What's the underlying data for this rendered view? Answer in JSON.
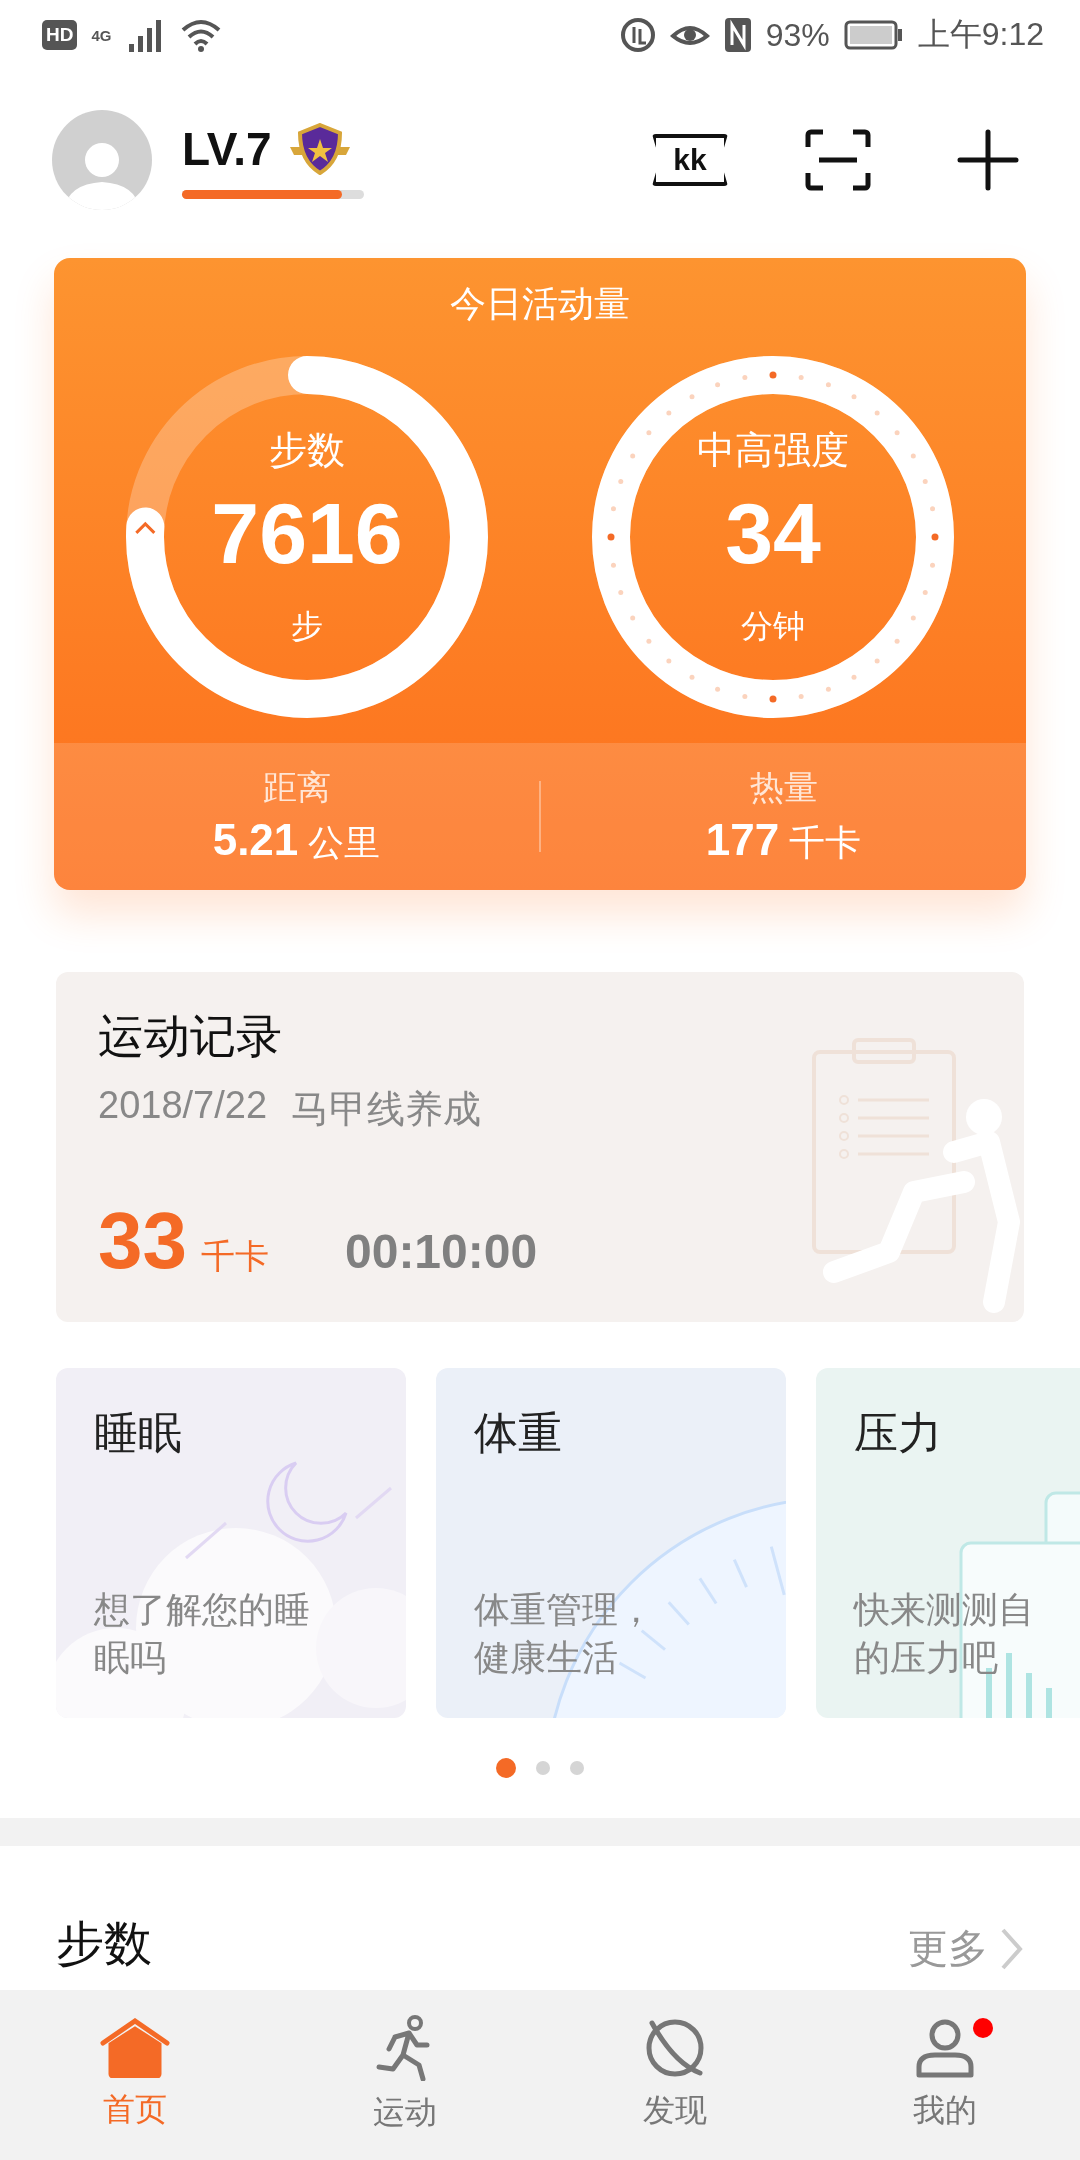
{
  "status_bar": {
    "hd": "HD",
    "network": "4G",
    "battery": "93%",
    "time": "上午9:12"
  },
  "header": {
    "level_label": "LV.7",
    "level": 0.88,
    "ticket_label": "kk"
  },
  "activity": {
    "title": "今日活动量",
    "rings": [
      {
        "kind": "plain",
        "label": "步数",
        "value": "7616",
        "unit": "步"
      },
      {
        "kind": "dotted",
        "label": "中高强度",
        "value": "34",
        "unit": "分钟"
      }
    ],
    "stats": [
      {
        "label": "距离",
        "value": "5.21",
        "unit": "公里"
      },
      {
        "label": "热量",
        "value": "177",
        "unit": "千卡"
      }
    ]
  },
  "record": {
    "title": "运动记录",
    "date": "2018/7/22",
    "name": "马甲线养成",
    "calories": "33",
    "calories_unit": "千卡",
    "duration": "00:10:00"
  },
  "cards": [
    {
      "kind": "sleep",
      "title": "睡眠",
      "lines": [
        "想了解您的睡",
        "眠吗"
      ]
    },
    {
      "kind": "weight",
      "title": "体重",
      "lines": [
        "体重管理，",
        "健康生活"
      ]
    },
    {
      "kind": "stress",
      "title": "压力",
      "lines": [
        "快来测测自",
        "的压力吧"
      ]
    }
  ],
  "pager": [
    {
      "selected": true
    },
    {
      "selected": false
    },
    {
      "selected": false
    }
  ],
  "steps_section": {
    "title": "步数",
    "more": "更多"
  },
  "nav": [
    {
      "kind": "home",
      "label": "首页",
      "selected": true,
      "badge": false
    },
    {
      "kind": "run",
      "label": "运动",
      "selected": false,
      "badge": false
    },
    {
      "kind": "discover",
      "label": "发现",
      "selected": false,
      "badge": false
    },
    {
      "kind": "me",
      "label": "我的",
      "selected": false,
      "badge": true
    }
  ]
}
